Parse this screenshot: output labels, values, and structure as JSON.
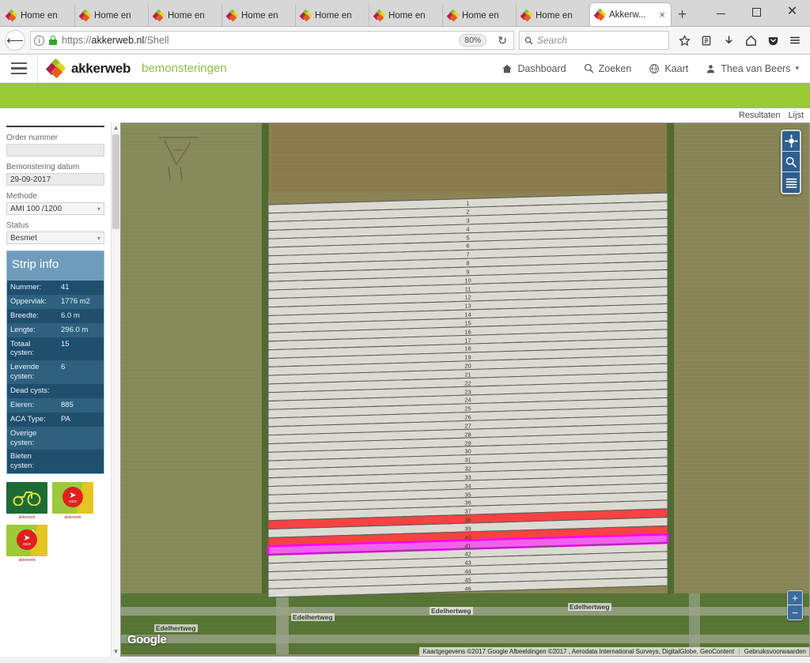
{
  "browser": {
    "tabs": [
      {
        "title": "Home en",
        "active": false
      },
      {
        "title": "Home en",
        "active": false
      },
      {
        "title": "Home en",
        "active": false
      },
      {
        "title": "Home en",
        "active": false
      },
      {
        "title": "Home en",
        "active": false
      },
      {
        "title": "Home en",
        "active": false
      },
      {
        "title": "Home en",
        "active": false
      },
      {
        "title": "Home en",
        "active": false
      },
      {
        "title": "Akkerw...",
        "active": true
      }
    ],
    "new_tab_label": "+",
    "close_tab_label": "×",
    "window_controls": {
      "minimize": "–",
      "maximize": "❐",
      "close": "✕"
    },
    "url_scheme": "https://",
    "url_host": "akkerweb.nl",
    "url_path": "/Shell",
    "zoom_level": "80%",
    "reload_label": "↻",
    "search_placeholder": "Search",
    "toolbar_icons": [
      "bookmark-star-icon",
      "library-icon",
      "downloads-icon",
      "home-icon",
      "pocket-icon",
      "menu-icon"
    ]
  },
  "app": {
    "brand_name": "akkerweb",
    "brand_sub": "bemonsteringen",
    "nav": [
      {
        "label": "Dashboard",
        "icon": "home-icon"
      },
      {
        "label": "Zoeken",
        "icon": "search-icon"
      },
      {
        "label": "Kaart",
        "icon": "globe-icon"
      },
      {
        "label": "Thea van Beers",
        "icon": "user-icon",
        "caret": "▾"
      }
    ],
    "accent_green": "#9ACA32"
  },
  "results_bar": {
    "links": [
      "Resultaten",
      "Lijst"
    ]
  },
  "sidebar": {
    "fields": [
      {
        "label": "Order nummer",
        "value": "",
        "type": "input",
        "name": "order-nummer"
      },
      {
        "label": "Bemonstering datum",
        "value": "29-09-2017",
        "type": "input",
        "name": "bemonstering-datum"
      },
      {
        "label": "Methode",
        "value": "AMI 100 /1200",
        "type": "select",
        "name": "methode"
      },
      {
        "label": "Status",
        "value": "Besmet",
        "type": "select",
        "name": "status"
      }
    ],
    "strip_info": {
      "title": "Strip info",
      "rows": [
        {
          "key": "Nummer:",
          "value": "41"
        },
        {
          "key": "Oppervlak:",
          "value": "1776 m2"
        },
        {
          "key": "Breedte:",
          "value": "6.0 m"
        },
        {
          "key": "Lengte:",
          "value": "296.0 m"
        },
        {
          "key": "Totaal cysten:",
          "value": "15"
        },
        {
          "key": "Levende cysten:",
          "value": "6"
        },
        {
          "key": "Dead cysts:",
          "value": ""
        },
        {
          "key": "Eieren:",
          "value": "885"
        },
        {
          "key": "ACA Type:",
          "value": "PA"
        },
        {
          "key": "Overige cysten:",
          "value": ""
        },
        {
          "key": "Bieten cysten:",
          "value": ""
        }
      ]
    },
    "app_tiles": [
      {
        "name": "tile-tractor",
        "caption": "akkerweb",
        "kind": "tractor"
      },
      {
        "name": "tile-geo",
        "caption": "GEO",
        "kind": "geo"
      },
      {
        "name": "tile-geo-plus",
        "caption": "GEO",
        "kind": "geo-plus"
      }
    ]
  },
  "map": {
    "provider_logo": "Google",
    "attribution_main": "Kaartgegevens ©2017 Google Afbeeldingen ©2017 , Aerodata International Surveys, DigitalGlobe, GeoContent",
    "attribution_terms": "Gebruiksvoorwaarden",
    "road_labels": [
      "Edelhertweg",
      "Edelhertweg",
      "Edelhertweg",
      "Edelhertweg"
    ],
    "zoom_in": "+",
    "zoom_out": "−",
    "controls": [
      "locate-icon",
      "search-icon",
      "layers-icon"
    ],
    "field": {
      "strip_count": 46,
      "selected_strip": 41,
      "infested_strips": [
        38,
        40
      ],
      "selected_color": "#ff00ff",
      "infested_color": "#f93535",
      "strip_numbers": [
        1,
        2,
        3,
        4,
        5,
        6,
        7,
        8,
        9,
        10,
        11,
        12,
        13,
        14,
        15,
        16,
        17,
        18,
        19,
        20,
        21,
        22,
        23,
        24,
        25,
        26,
        27,
        28,
        29,
        30,
        31,
        32,
        33,
        34,
        35,
        36,
        37,
        38,
        39,
        40,
        41,
        42,
        43,
        44,
        45,
        46
      ]
    }
  }
}
